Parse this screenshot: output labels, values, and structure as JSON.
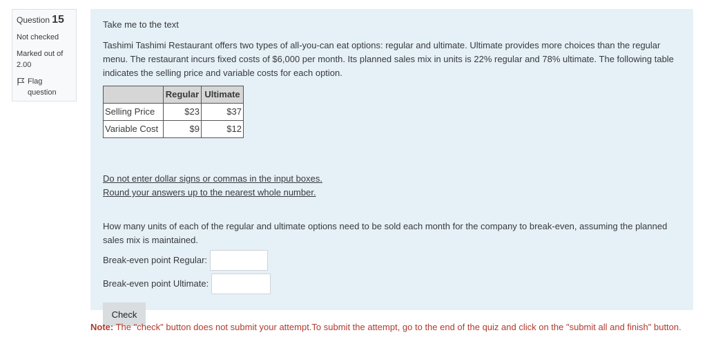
{
  "info": {
    "question_label": "Question",
    "question_number": "15",
    "status": "Not checked",
    "marked_out_of_label": "Marked out of",
    "marked_out_of_value": "2.00",
    "flag_line1": "Flag",
    "flag_line2": "question"
  },
  "content": {
    "take_me_link": "Take me to the text",
    "paragraph": "Tashimi Tashimi Restaurant offers two types of all-you-can eat options: regular and ultimate. Ultimate provides more choices than the regular menu. The restaurant incurs fixed costs of $6,000 per month. Its planned sales mix in units is 22% regular and 78% ultimate. The following table indicates the selling price and variable costs for each option.",
    "table": {
      "headers": [
        "",
        "Regular",
        "Ultimate"
      ],
      "rows": [
        {
          "label": "Selling Price",
          "regular": "$23",
          "ultimate": "$37"
        },
        {
          "label": "Variable Cost",
          "regular": "$9",
          "ultimate": "$12"
        }
      ]
    },
    "instruction1": "Do not enter dollar signs or commas in the input boxes.",
    "instruction2": "Round your answers up to the nearest whole number.",
    "question": "How many units of each of the regular and ultimate options need to be sold each month for the company to break-even, assuming the planned sales mix is maintained.",
    "answer1_label": "Break-even point Regular:",
    "answer1_value": "",
    "answer2_label": "Break-even point Ultimate:",
    "answer2_value": "",
    "check_button": "Check"
  },
  "note": {
    "prefix": "Note:",
    "text": " The \"check\" button does not submit your attempt.To submit the attempt, go to the end of the quiz and click on the \"submit all and finish\" button."
  }
}
